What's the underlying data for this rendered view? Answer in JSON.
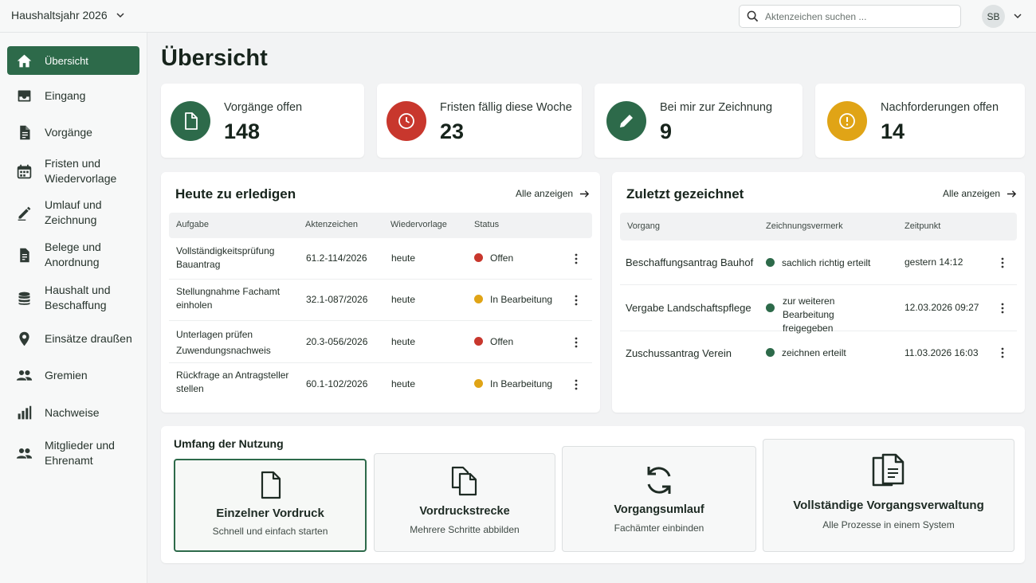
{
  "topbar": {
    "year": "Haushaltsjahr 2026",
    "search_placeholder": "Aktenzeichen suchen ...",
    "avatar_initials": "SB"
  },
  "sidebar": {
    "items": [
      {
        "label": "Übersicht",
        "icon": "home-icon",
        "active": true
      },
      {
        "label": "Eingang",
        "icon": "inbox-icon"
      },
      {
        "label": "Vorgänge",
        "icon": "document-icon"
      },
      {
        "label": "Fristen und Wiedervorlage",
        "icon": "calendar-icon"
      },
      {
        "label": "Umlauf und Zeichnung",
        "icon": "pen-icon"
      },
      {
        "label": "Belege und Anordnung",
        "icon": "receipt-icon"
      },
      {
        "label": "Haushalt und Beschaffung",
        "icon": "coins-icon"
      },
      {
        "label": "Einsätze draußen",
        "icon": "location-pin-icon"
      },
      {
        "label": "Gremien",
        "icon": "group-icon"
      },
      {
        "label": "Nachweise",
        "icon": "bar-chart-icon"
      },
      {
        "label": "Mitglieder und Ehrenamt",
        "icon": "people-icon"
      }
    ]
  },
  "page_title": "Übersicht",
  "kpis": [
    {
      "label": "Vorgänge offen",
      "value": "148",
      "icon": "document-icon",
      "color": "#2d6a4a"
    },
    {
      "label": "Fristen fällig diese Woche",
      "value": "23",
      "icon": "clock-icon",
      "color": "#c8372d"
    },
    {
      "label": "Bei mir zur Zeichnung",
      "value": "9",
      "icon": "pen-icon",
      "color": "#2d6a4a"
    },
    {
      "label": "Nachforderungen offen",
      "value": "14",
      "icon": "alert-icon",
      "color": "#e0a416"
    }
  ],
  "today": {
    "title": "Heute zu erledigen",
    "show_all": "Alle anzeigen",
    "columns": [
      "Aufgabe",
      "Aktenzeichen",
      "Wiedervorlage",
      "Status"
    ],
    "rows": [
      {
        "task": "Vollständigkeitsprüfung Bauantrag",
        "ref": "61.2-114/2026",
        "due": "heute",
        "status": "Offen",
        "status_color": "#c8372d"
      },
      {
        "task": "Stellungnahme Fachamt einholen",
        "ref": "32.1-087/2026",
        "due": "heute",
        "status": "In Bearbeitung",
        "status_color": "#e0a416"
      },
      {
        "task": "Unterlagen prüfen Zuwendungsnachweis",
        "ref": "20.3-056/2026",
        "due": "heute",
        "status": "Offen",
        "status_color": "#c8372d"
      },
      {
        "task": "Rückfrage an Antragsteller stellen",
        "ref": "60.1-102/2026",
        "due": "heute",
        "status": "In Bearbeitung",
        "status_color": "#e0a416"
      }
    ]
  },
  "signed": {
    "title": "Zuletzt gezeichnet",
    "show_all": "Alle anzeigen",
    "columns": [
      "Vorgang",
      "Zeichnungsvermerk",
      "Zeitpunkt"
    ],
    "rows": [
      {
        "name": "Beschaffungsantrag Bauhof",
        "note": "sachlich richtig erteilt",
        "time": "gestern 14:12",
        "status_color": "#2d6a4a"
      },
      {
        "name": "Vergabe Landschaftspflege",
        "note": "zur weiteren Bearbeitung freigegeben",
        "time": "12.03.2026 09:27",
        "status_color": "#2d6a4a"
      },
      {
        "name": "Zuschussantrag Verein",
        "note": "zeichnen erteilt",
        "time": "11.03.2026 16:03",
        "status_color": "#2d6a4a"
      }
    ]
  },
  "usage": {
    "title": "Umfang der Nutzung",
    "options": [
      {
        "title": "Einzelner Vordruck",
        "subtitle": "Schnell und einfach starten",
        "icon": "document-icon",
        "selected": true
      },
      {
        "title": "Vordruckstrecke",
        "subtitle": "Mehrere Schritte abbilden",
        "icon": "copy-documents-icon"
      },
      {
        "title": "Vorgangsumlauf",
        "subtitle": "Fachämter einbinden",
        "icon": "refresh-icon"
      },
      {
        "title": "Vollständige Vorgangsverwaltung",
        "subtitle": "Alle Prozesse in einem System",
        "icon": "documents-stack-icon"
      }
    ]
  },
  "colors": {
    "accent": "#2d6a4a",
    "danger": "#c8372d",
    "warning": "#e0a416"
  }
}
